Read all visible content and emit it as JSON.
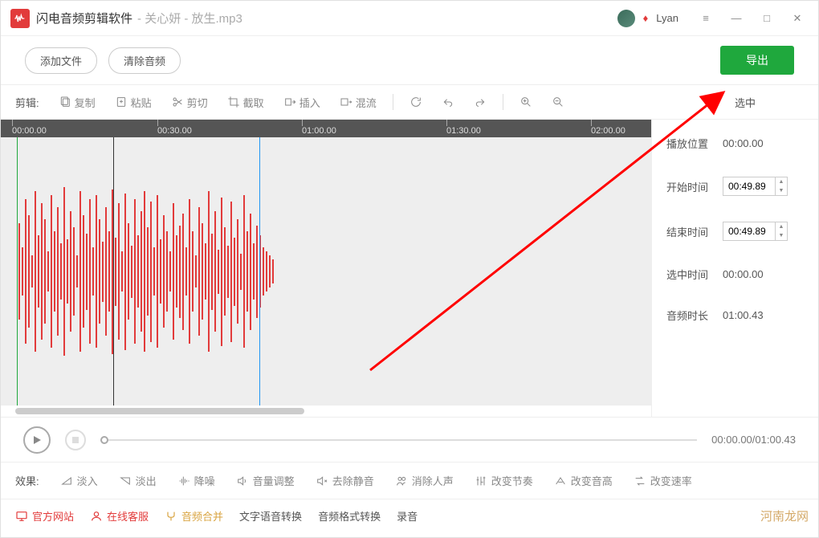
{
  "title": {
    "app_name": "闪电音频剪辑软件",
    "file_name": "关心妍 - 放生.mp3"
  },
  "user": {
    "name": "Lyan"
  },
  "toolbar": {
    "add_file": "添加文件",
    "clear_audio": "清除音频",
    "export": "导出"
  },
  "edit": {
    "label": "剪辑:",
    "copy": "复制",
    "paste": "粘贴",
    "cut": "剪切",
    "crop": "截取",
    "insert": "插入",
    "mix": "混流"
  },
  "side": {
    "selected_label": "选中"
  },
  "ruler": [
    "00:00.00",
    "00:30.00",
    "01:00.00",
    "01:30.00",
    "02:00.00"
  ],
  "info": {
    "play_pos_label": "播放位置",
    "play_pos": "00:00.00",
    "start_label": "开始时间",
    "start": "00:49.89",
    "end_label": "结束时间",
    "end": "00:49.89",
    "sel_label": "选中时间",
    "sel": "00:00.00",
    "dur_label": "音频时长",
    "dur": "01:00.43"
  },
  "playback": {
    "time": "00:00.00/01:00.43"
  },
  "effects": {
    "label": "效果:",
    "fade_in": "淡入",
    "fade_out": "淡出",
    "denoise": "降噪",
    "volume": "音量调整",
    "trim_silence": "去除静音",
    "remove_vocal": "消除人声",
    "tempo": "改变节奏",
    "pitch": "改变音高",
    "speed": "改变速率"
  },
  "footer": {
    "website": "官方网站",
    "support": "在线客服",
    "merge": "音频合并",
    "tts": "文字语音转换",
    "format": "音频格式转换",
    "record": "录音"
  },
  "watermark": "河南龙网",
  "waveform_heights": [
    120,
    60,
    180,
    140,
    40,
    200,
    90,
    170,
    130,
    50,
    190,
    100,
    160,
    70,
    210,
    80,
    150,
    110,
    40,
    200,
    140,
    95,
    180,
    60,
    190,
    130,
    75,
    160,
    100,
    205,
    85,
    170,
    50,
    195,
    120,
    65,
    180,
    90,
    150,
    200,
    110,
    175,
    60,
    190,
    80,
    140,
    100,
    50,
    170,
    90,
    115,
    145,
    60,
    180,
    100,
    40,
    160,
    120,
    70,
    200,
    95,
    150,
    55,
    185,
    110,
    65,
    175,
    85,
    130,
    45,
    190,
    100,
    145,
    70,
    115,
    90,
    60,
    50,
    40,
    30
  ]
}
